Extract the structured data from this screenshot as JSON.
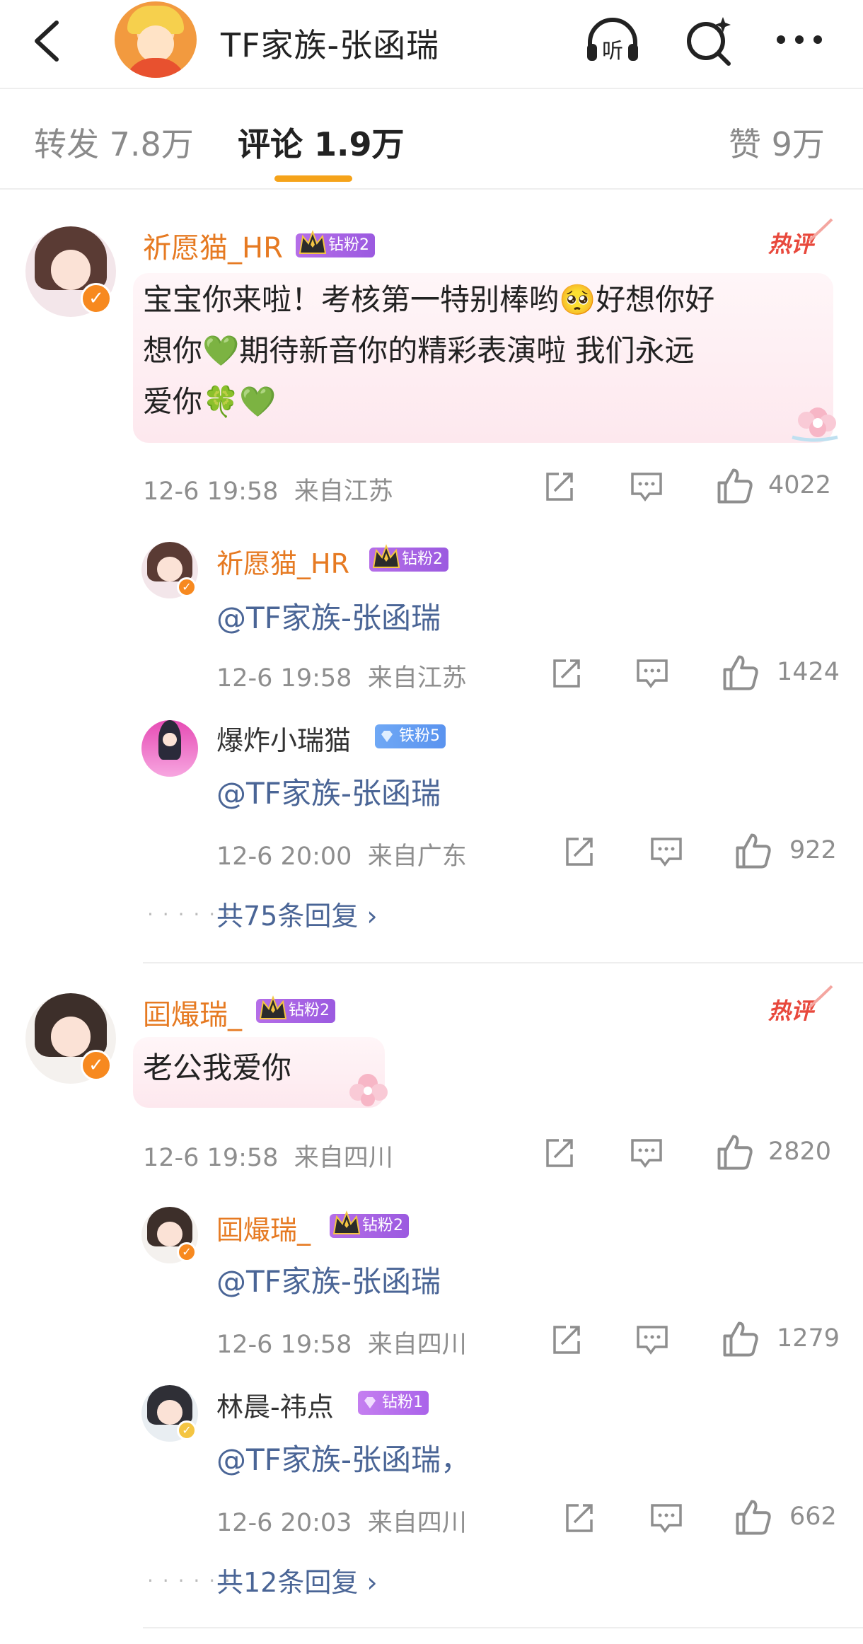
{
  "header": {
    "title": "TF家族-张函瑞",
    "listen_label": "听"
  },
  "tabs": {
    "repost": "转发 7.8万",
    "comments": "评论 1.9万",
    "likes": "赞 9万"
  },
  "colors": {
    "accent": "#f5a31a",
    "username": "#e67a22",
    "link": "#4a6596",
    "hot": "#e8483c"
  },
  "comments": [
    {
      "name": "祈愿猫_HR",
      "fan_badge": "钻粉2",
      "hot": "热评",
      "text_lines": [
        "宝宝你来啦！考核第一特别棒哟🥺好想你好",
        "想你💚期待新音你的精彩表演啦 我们永远",
        "爱你🍀💚"
      ],
      "time": "12-6 19:58",
      "location": "来自江苏",
      "likes": "4022",
      "replies": [
        {
          "name": "祈愿猫_HR",
          "fan_badge": "钻粉2",
          "text": "@TF家族-张函瑞",
          "time": "12-6 19:58",
          "location": "来自江苏",
          "likes": "1424"
        },
        {
          "name": "爆炸小瑞猫",
          "fan_badge": "铁粉5",
          "text": "@TF家族-张函瑞",
          "time": "12-6 20:00",
          "location": "来自广东",
          "likes": "922"
        }
      ],
      "more_replies": "共75条回复 ›"
    },
    {
      "name": "囸熶瑞_",
      "fan_badge": "钻粉2",
      "hot": "热评",
      "text_lines": [
        "老公我爱你"
      ],
      "time": "12-6 19:58",
      "location": "来自四川",
      "likes": "2820",
      "replies": [
        {
          "name": "囸熶瑞_",
          "fan_badge": "钻粉2",
          "text": "@TF家族-张函瑞",
          "time": "12-6 19:58",
          "location": "来自四川",
          "likes": "1279"
        },
        {
          "name": "林晨-祎点",
          "fan_badge": "钻粉1",
          "text": "@TF家族-张函瑞，",
          "time": "12-6 20:03",
          "location": "来自四川",
          "likes": "662"
        }
      ],
      "more_replies": "共12条回复 ›"
    }
  ],
  "icons": {
    "back": "chevron-left-icon",
    "listen": "headphones-icon",
    "search": "sparkle-search-icon",
    "more": "more-dots-icon",
    "share": "share-icon",
    "reply": "comment-icon",
    "like": "thumbs-up-icon",
    "verified": "verified-badge-icon"
  }
}
